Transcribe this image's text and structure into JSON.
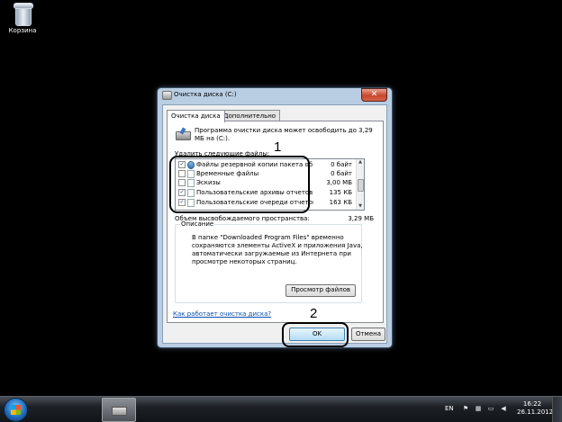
{
  "desktop": {
    "recycle_bin_label": "Корзина"
  },
  "window": {
    "title": "Очистка диска  (C:)",
    "close_glyph": "✕",
    "tabs": [
      {
        "label": "Очистка диска"
      },
      {
        "label": "Дополнительно"
      }
    ],
    "intro_text": "Программа очистки диска может освободить до 3,29 МБ на  (C:).",
    "files_label": "Удалить следующие файлы:",
    "files": [
      {
        "name": "Файлы резервной копии пакета об...",
        "size": "0 байт",
        "checked": true,
        "icon": "gear-icon"
      },
      {
        "name": "Временные файлы",
        "size": "0 байт",
        "checked": false,
        "icon": "file-icon"
      },
      {
        "name": "Эскизы",
        "size": "3,00 МБ",
        "checked": false,
        "icon": "file-icon"
      },
      {
        "name": "Пользовательские архивы отчетов ...",
        "size": "135 КБ",
        "checked": true,
        "icon": "file-icon"
      },
      {
        "name": "Пользовательские очереди отчетов...",
        "size": "163 КБ",
        "checked": true,
        "icon": "file-icon"
      }
    ],
    "space_label": "Объем высвобождаемого пространства:",
    "space_value": "3,29 МБ",
    "description_label": "Описание",
    "description_text": "В папке \"Downloaded Program Files\" временно сохраняются элементы ActiveX и приложения Java, автоматически загружаемые из Интернета при просмотре некоторых страниц.",
    "view_files_button": "Просмотр файлов",
    "help_link": "Как работает очистка диска?",
    "ok_button": "OK",
    "cancel_button": "Отмена"
  },
  "annotations": {
    "callout1_number": "1",
    "callout2_number": "2"
  },
  "taskbar": {
    "language": "EN",
    "time": "16:22",
    "date": "26.11.2012"
  },
  "colors": {
    "desktop": "#000000",
    "window_frame": "#b9cde3",
    "close_button": "#c8462c",
    "link": "#0a4fb1"
  }
}
